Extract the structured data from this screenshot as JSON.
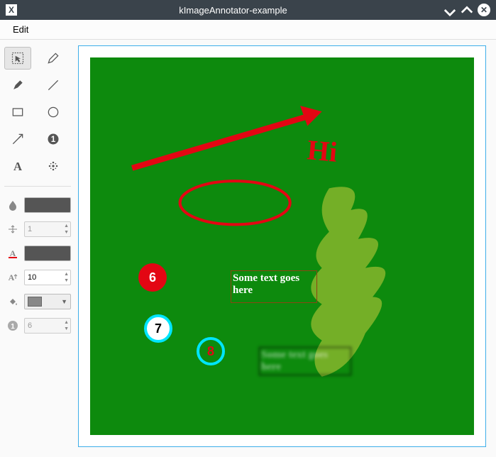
{
  "window": {
    "title": "kImageAnnotator-example",
    "logo": "X"
  },
  "menubar": {
    "edit": "Edit"
  },
  "tools": {
    "select": "select",
    "pen": "pen",
    "marker": "marker",
    "line": "line",
    "rectangle": "rectangle",
    "ellipse": "ellipse",
    "arrow": "arrow",
    "number": "number",
    "text": "text",
    "blur": "blur"
  },
  "properties": {
    "opacity_value": "",
    "width_value": "1",
    "font_size_value": "10",
    "number_seed_value": "6",
    "stroke_color": "#555555",
    "text_color": "#555555",
    "fill_color": "#888888"
  },
  "canvas": {
    "annotations": {
      "textbox1_line1": "Some text goes",
      "textbox1_line2": "here",
      "textbox2_line1": "Some text goes",
      "textbox2_line2": "here",
      "number6": "6",
      "number7": "7",
      "number8": "8",
      "handwriting": "Hi"
    }
  }
}
